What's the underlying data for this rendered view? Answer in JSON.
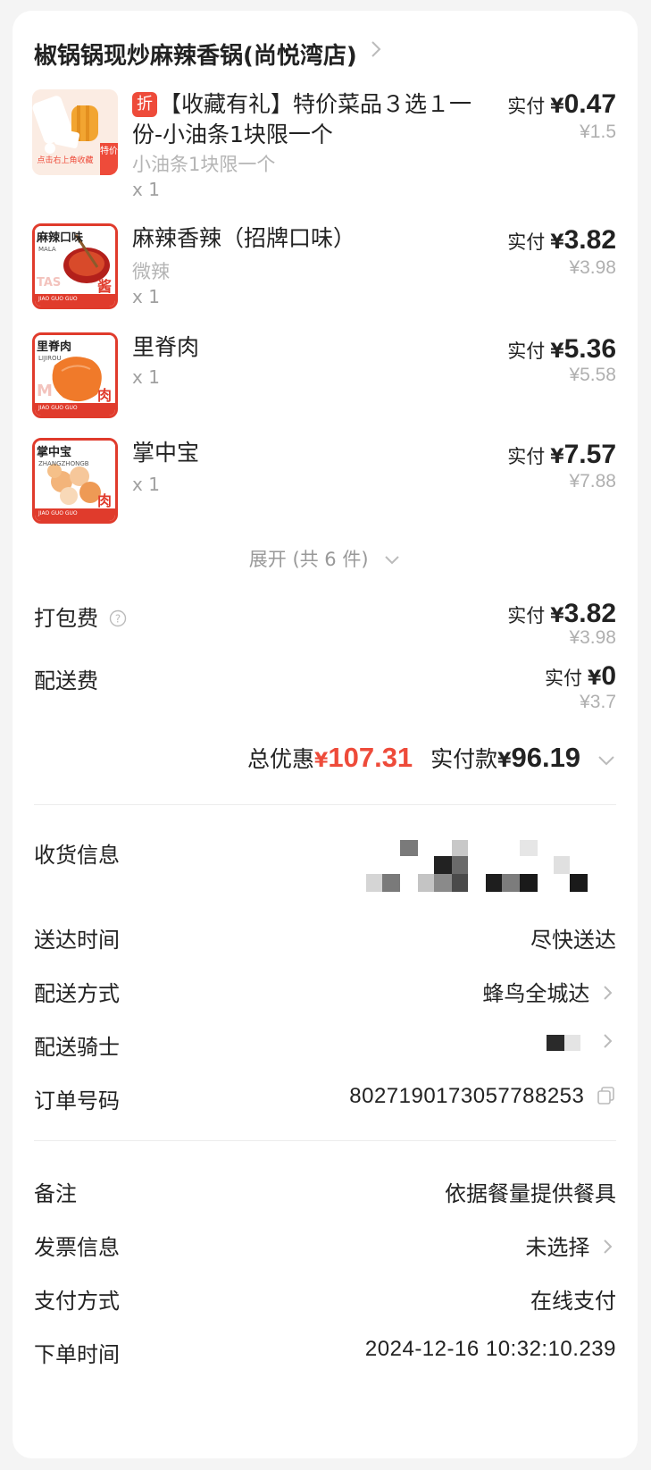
{
  "store": {
    "name": "椒锅锅现炒麻辣香锅(尚悦湾店)"
  },
  "items": [
    {
      "tag": "折",
      "name": "【收藏有礼】特价菜品３选１一份-小油条1块限一个",
      "spec": "小油条1块限一个",
      "qty": "x 1",
      "paid_label": "实付",
      "currency": "¥",
      "paid": "0.47",
      "original": "¥1.5",
      "thumb_label": "点击右上角收藏",
      "thumb_badge": "特价"
    },
    {
      "name": "麻辣香辣（招牌口味）",
      "spec": "微辣",
      "qty": "x 1",
      "paid_label": "实付",
      "currency": "¥",
      "paid": "3.82",
      "original": "¥3.98",
      "thumb_label": "麻辣口味",
      "thumb_sub": "MALA",
      "thumb_badge": "酱",
      "thumb_brand": "JIAO GUO GUO",
      "thumb_bg": "TAS"
    },
    {
      "name": "里脊肉",
      "spec": "",
      "qty": "x 1",
      "paid_label": "实付",
      "currency": "¥",
      "paid": "5.36",
      "original": "¥5.58",
      "thumb_label": "里脊肉",
      "thumb_sub": "LIJIROU",
      "thumb_badge": "肉",
      "thumb_brand": "JIAO GUO GUO",
      "thumb_bg": "M"
    },
    {
      "name": "掌中宝",
      "spec": "",
      "qty": "x 1",
      "paid_label": "实付",
      "currency": "¥",
      "paid": "7.57",
      "original": "¥7.88",
      "thumb_label": "掌中宝",
      "thumb_sub": "ZHANGZHONGB",
      "thumb_badge": "肉",
      "thumb_brand": "JIAO GUO GUO"
    }
  ],
  "expand_label": "展开 (共 6 件)",
  "packing": {
    "label": "打包费",
    "paid_label": "实付",
    "currency": "¥",
    "paid": "3.82",
    "original": "¥3.98"
  },
  "delivery_fee": {
    "label": "配送费",
    "paid_label": "实付",
    "currency": "¥",
    "paid": "0",
    "original": "¥3.7"
  },
  "summary": {
    "discount_label": "总优惠",
    "currency": "¥",
    "discount": "107.31",
    "paid_label": "实付款",
    "paid": "96.19"
  },
  "info": [
    {
      "label": "收货信息",
      "value": ""
    },
    {
      "label": "送达时间",
      "value": "尽快送达"
    },
    {
      "label": "配送方式",
      "value": "蜂鸟全城达"
    },
    {
      "label": "配送骑士",
      "value": ""
    },
    {
      "label": "订单号码",
      "value": "8027190173057788253"
    }
  ],
  "extra": [
    {
      "label": "备注",
      "value": "依据餐量提供餐具"
    },
    {
      "label": "发票信息",
      "value": "未选择"
    },
    {
      "label": "支付方式",
      "value": "在线支付"
    },
    {
      "label": "下单时间",
      "value": "2024-12-16 10:32:10.239"
    }
  ],
  "colors": {
    "accent_red": "#ee4b3a",
    "muted": "#b0b0b0",
    "text": "#222222",
    "card": "#ffffff",
    "page": "#f4f4f4"
  }
}
